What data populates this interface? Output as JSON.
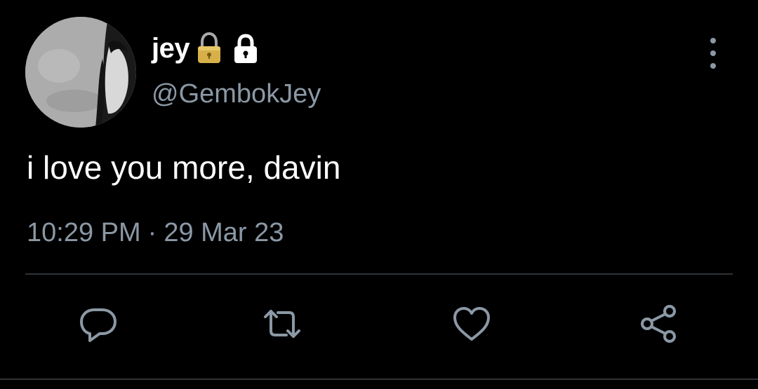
{
  "tweet": {
    "author": {
      "display_name": "jey",
      "handle": "@GembokJey",
      "avatar_icon": "profile-photo",
      "name_emoji_icon": "lock-emoji",
      "protected_icon": "lock-badge-icon"
    },
    "text": "i love you more, davin",
    "time": "10:29 PM",
    "separator": "·",
    "date": "29 Mar 23",
    "menu_icon": "more-vertical-icon",
    "actions": [
      {
        "name": "reply",
        "icon": "reply-icon"
      },
      {
        "name": "retweet",
        "icon": "retweet-icon"
      },
      {
        "name": "like",
        "icon": "heart-icon"
      },
      {
        "name": "share",
        "icon": "share-icon"
      }
    ]
  },
  "colors": {
    "background": "#000000",
    "primary_text": "#ffffff",
    "secondary_text": "#8b98a5",
    "divider": "#2f3336",
    "lock_gold": "#d8b04a"
  }
}
